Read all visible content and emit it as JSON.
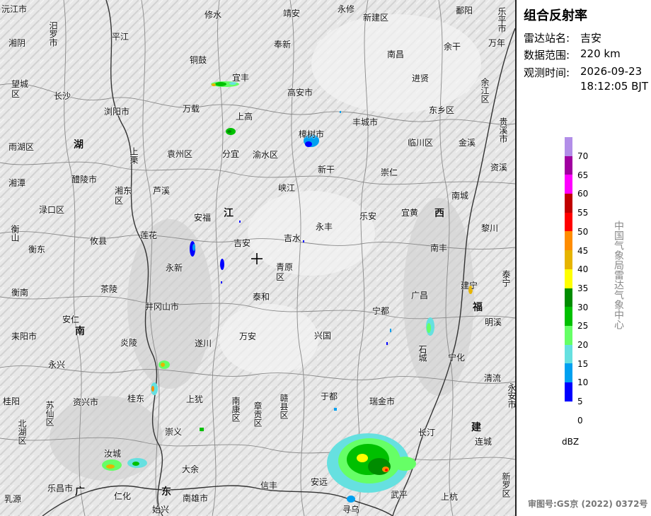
{
  "panel": {
    "title": "组合反射率",
    "station_label": "雷达站名:",
    "station_value": "吉安",
    "range_label": "数据范围:",
    "range_value": "220 km",
    "time_label": "观测时间:",
    "time_date": "2026-09-23",
    "time_clock": "18:12:05 BJT",
    "legend_unit": "dBZ",
    "agency": "中国气象局雷达气象中心",
    "review_number": "审图号:GS京 (2022) 0372号"
  },
  "legend": [
    {
      "label": "70",
      "color": "#b28ee8"
    },
    {
      "label": "65",
      "color": "#a000a0"
    },
    {
      "label": "60",
      "color": "#ff00ff"
    },
    {
      "label": "55",
      "color": "#c00000"
    },
    {
      "label": "50",
      "color": "#ff0000"
    },
    {
      "label": "45",
      "color": "#ff8c00"
    },
    {
      "label": "40",
      "color": "#e6b400"
    },
    {
      "label": "35",
      "color": "#ffff00"
    },
    {
      "label": "30",
      "color": "#008c00"
    },
    {
      "label": "25",
      "color": "#00c000"
    },
    {
      "label": "20",
      "color": "#66ff66"
    },
    {
      "label": "15",
      "color": "#66e0e0"
    },
    {
      "label": "10",
      "color": "#00a0f0"
    },
    {
      "label": "5",
      "color": "#0000ff"
    },
    {
      "label": "0",
      "color": "#ffffff"
    }
  ],
  "provinces": [
    "湖",
    "南",
    "江",
    "西",
    "福",
    "建",
    "广",
    "东"
  ],
  "places": [
    "沅江市",
    "修水",
    "靖安",
    "永修",
    "新建区",
    "鄱阳",
    "乐平市",
    "汨罗市",
    "平江",
    "湘阴",
    "奉新",
    "南昌",
    "余干",
    "万年",
    "铜鼓",
    "宜丰",
    "进贤",
    "望城区",
    "长沙",
    "高安市",
    "余江区",
    "浏阳市",
    "万载",
    "东乡区",
    "贵溪市",
    "上高",
    "丰城市",
    "樟树市",
    "临川区",
    "金溪",
    "雨湖区",
    "上栗",
    "袁州区",
    "分宜",
    "渝水区",
    "新干",
    "崇仁",
    "资溪",
    "湘潭",
    "醴陵市",
    "芦溪",
    "峡江",
    "南城",
    "湘东区",
    "渌口区",
    "安福",
    "乐安",
    "宜黄",
    "衡山",
    "莲花",
    "吉安",
    "吉水",
    "永丰",
    "黎川",
    "衡东",
    "攸县",
    "永新",
    "青原区",
    "南丰",
    "泰宁",
    "衡南",
    "茶陵",
    "泰和",
    "广昌",
    "建宁",
    "井冈山市",
    "安仁",
    "宁都",
    "明溪",
    "耒阳市",
    "万安",
    "兴国",
    "炎陵",
    "遂川",
    "石城",
    "宁化",
    "永兴",
    "桂东",
    "于都",
    "清流",
    "桂阳",
    "资兴市",
    "上犹",
    "南康区",
    "章贡区",
    "赣县区",
    "瑞金市",
    "苏仙区",
    "长汀",
    "永安市",
    "北湖区",
    "崇义",
    "连城",
    "汝城",
    "大余",
    "乐昌市",
    "仁化",
    "南雄市",
    "信丰",
    "安远",
    "武平",
    "新罗区",
    "上杭",
    "乳源",
    "始兴",
    "寻乌"
  ]
}
